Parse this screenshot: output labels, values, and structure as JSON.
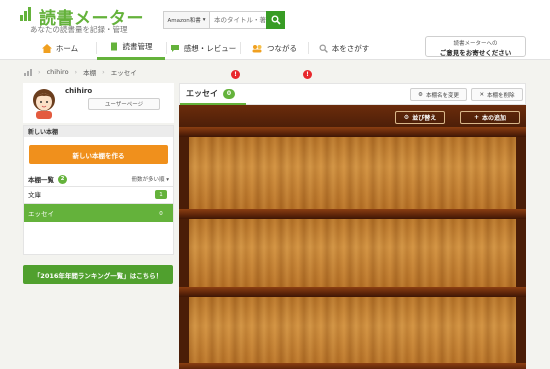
{
  "header": {
    "logo_text": "読書メーター",
    "logo_sub": "あなたの読書量を記録・管理",
    "search_select": "Amazon和書",
    "search_placeholder": "本のタイトル・著者名"
  },
  "nav": {
    "items": [
      {
        "label": "ホーム"
      },
      {
        "label": "読書管理"
      },
      {
        "label": "感想・レビュー",
        "badge": "!"
      },
      {
        "label": "つながる",
        "badge": "!"
      },
      {
        "label": "本をさがす"
      }
    ],
    "feedback_line1": "読書メーターへの",
    "feedback_line2": "ご意見をお寄せください"
  },
  "breadcrumb": [
    "chihiro",
    "本棚",
    "エッセイ"
  ],
  "sidebar": {
    "username": "chihiro",
    "user_page_label": "ユーザーページ",
    "new_shelf_heading": "新しい本棚",
    "new_shelf_button": "新しい本棚を作る",
    "shelf_list_heading": "本棚一覧",
    "shelf_list_count": "2",
    "sort_label": "冊数が多い順",
    "shelves": [
      {
        "name": "文庫",
        "count": "1"
      },
      {
        "name": "エッセイ",
        "count": "0"
      }
    ],
    "ranking_button": "「2016年年間ランキング一覧」はこちら！"
  },
  "main": {
    "tab_label": "エッセイ",
    "tab_count": "0",
    "rename_label": "本棚名を変更",
    "delete_label": "本棚を削除",
    "sort_button": "並び替え",
    "add_book_button": "本の追加"
  },
  "colors": {
    "brand_green": "#64b23b",
    "orange": "#f0901c",
    "alert_red": "#e8282d"
  }
}
